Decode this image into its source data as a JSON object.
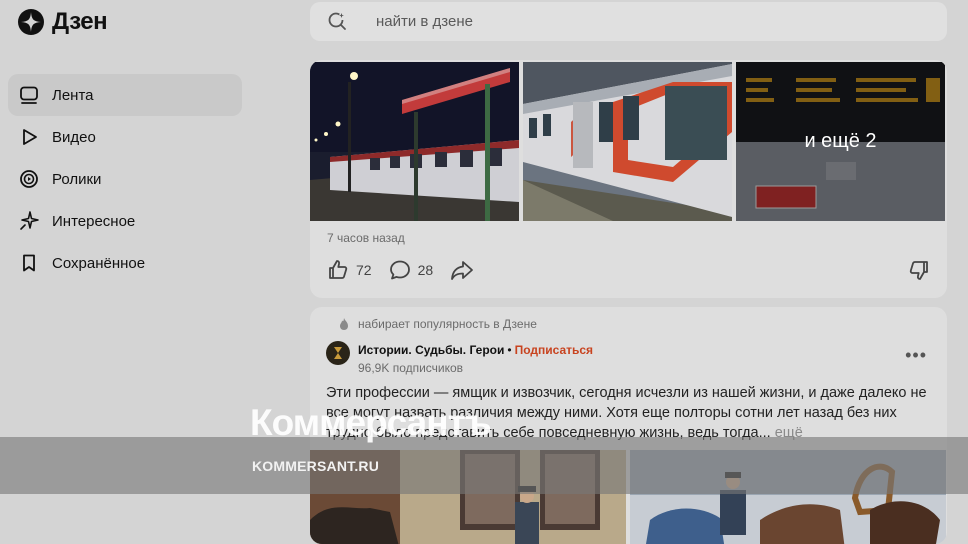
{
  "brand": {
    "name": "Дзен"
  },
  "nav": [
    {
      "label": "Лента",
      "icon": "feed-icon",
      "active": true
    },
    {
      "label": "Видео",
      "icon": "play-icon"
    },
    {
      "label": "Ролики",
      "icon": "shorts-icon"
    },
    {
      "label": "Интересное",
      "icon": "sparkle-icon"
    },
    {
      "label": "Сохранённое",
      "icon": "bookmark-icon"
    }
  ],
  "search": {
    "placeholder": "найти в дзене"
  },
  "card1": {
    "more_photos": "и ещё 2",
    "timestamp": "7 часов назад",
    "likes": "72",
    "comments": "28"
  },
  "card2": {
    "popular": "набирает популярность в Дзене",
    "channel_name": "Истории. Судьбы. Герои",
    "separator": "•",
    "subscribe": "Подписаться",
    "subscribers": "96,9K подписчиков",
    "text": "Эти профессии — ямщик и извозчик, сегодня исчезли из нашей жизни, и даже далеко не все могут назвать различия между ними. Хотя еще полторы сотни лет назад без них трудно было представить себе повседневную жизнь, ведь тогда...",
    "more": "ещё"
  },
  "watermark": {
    "title": "Коммерсантъ",
    "subtitle": "KOMMERSANT.RU"
  },
  "colors": {
    "accent": "#c8431f",
    "page_bg": "#d4d4d4",
    "card_bg": "#dedede"
  }
}
